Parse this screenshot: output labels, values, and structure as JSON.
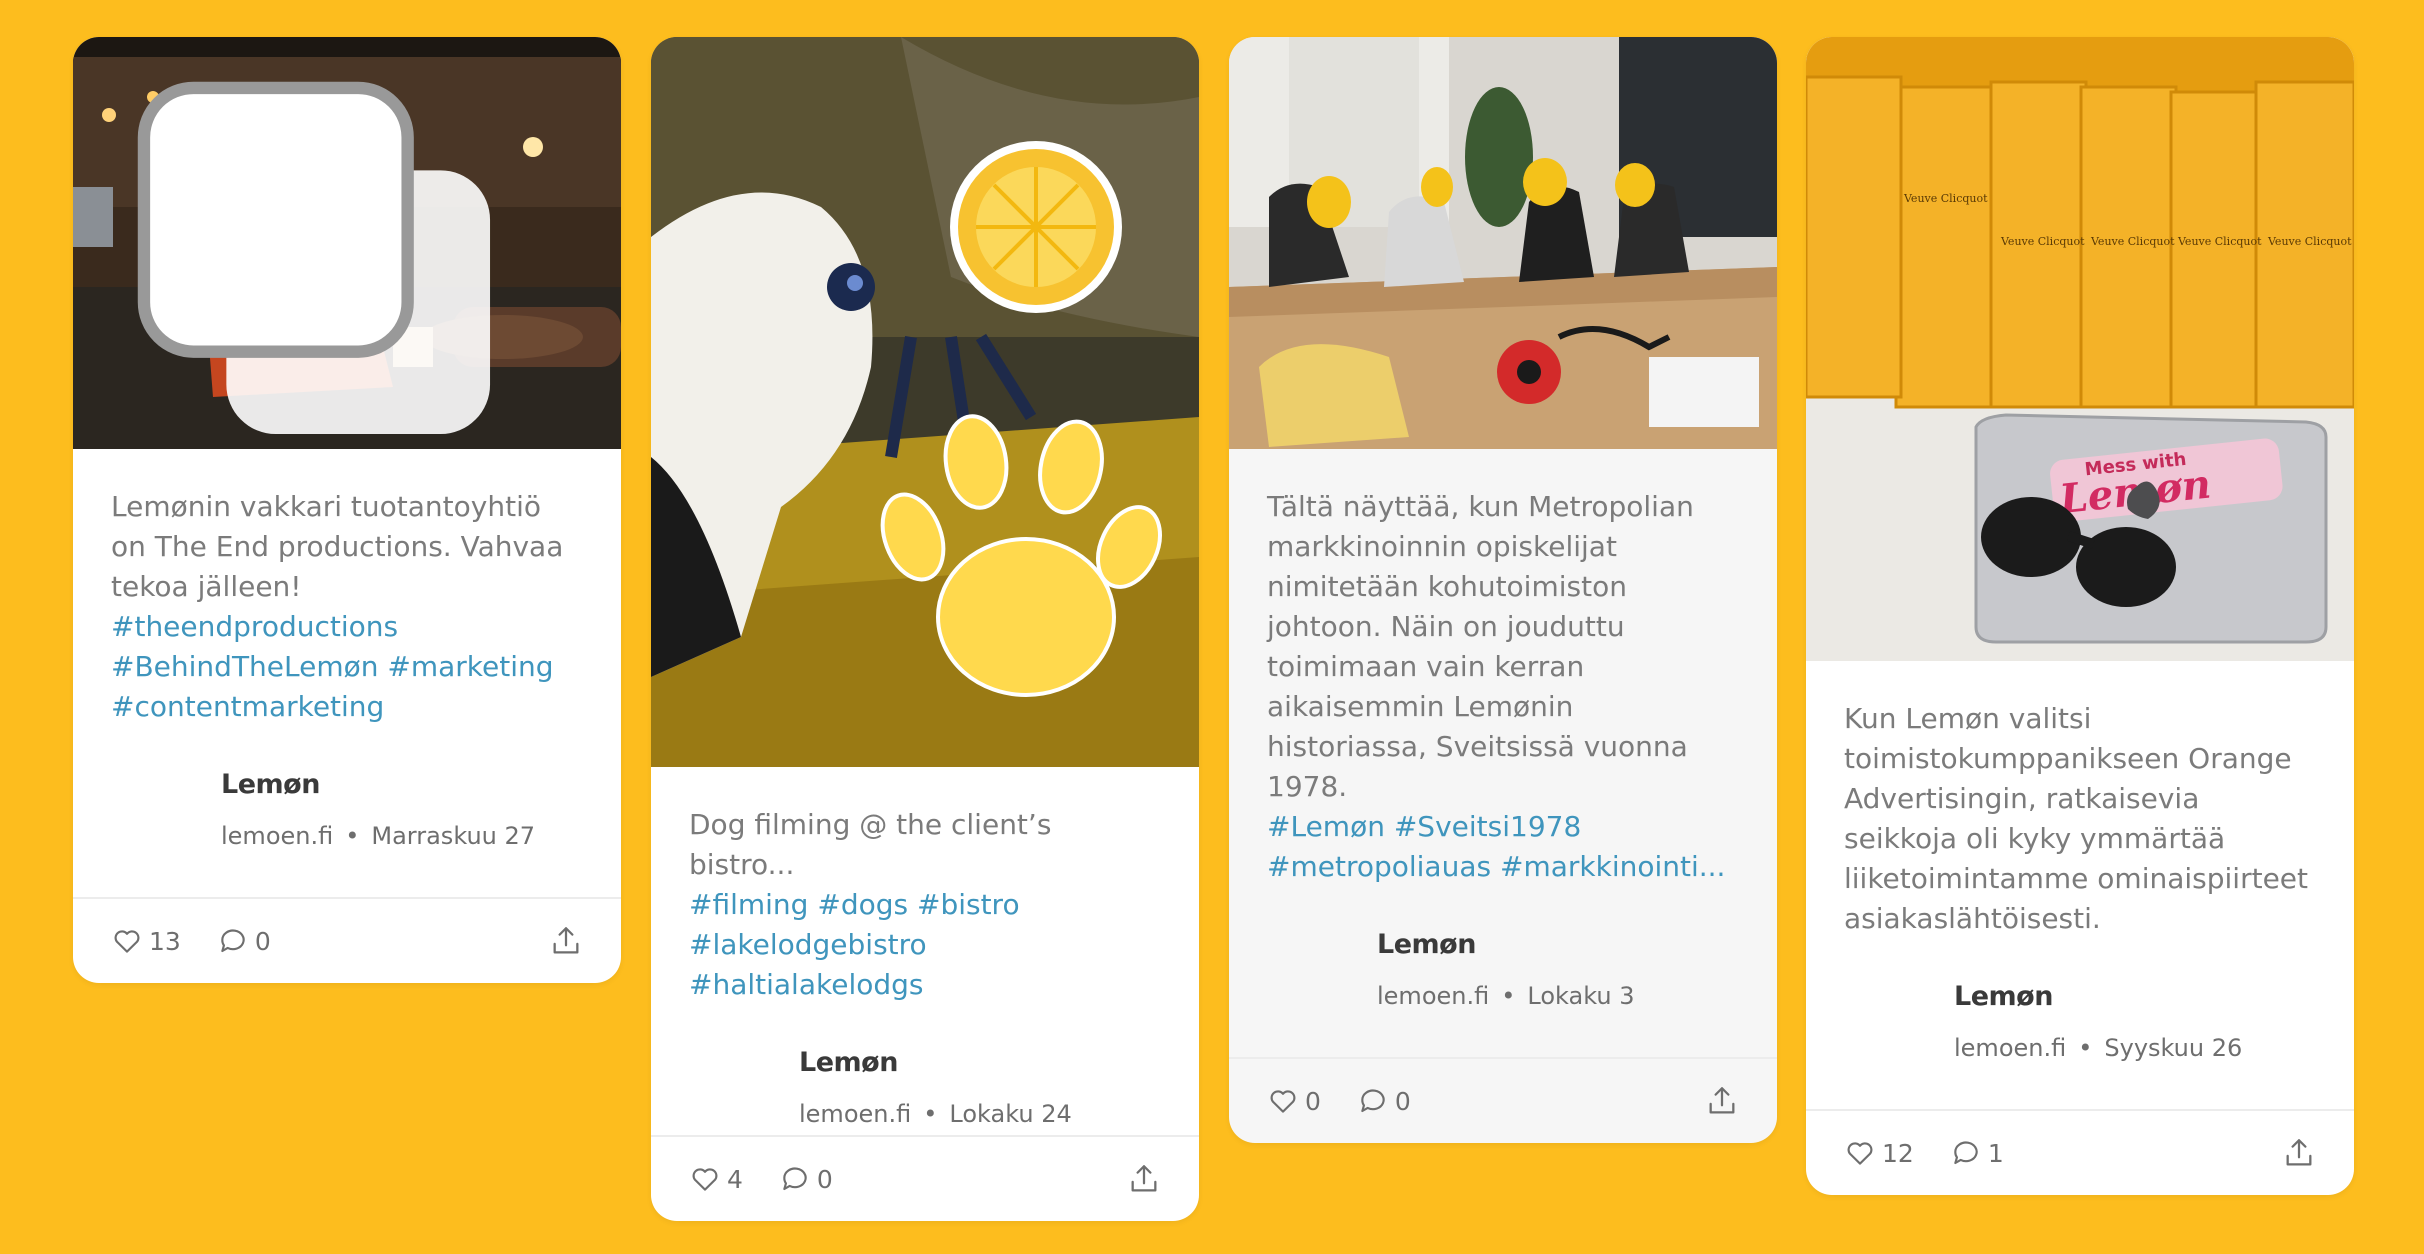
{
  "colors": {
    "background": "#fdbd1e",
    "card": "#ffffff",
    "caption": "#7b7b7b",
    "hashtag": "#3f95bd"
  },
  "posts": [
    {
      "image_desc": "man-in-restaurant-holding-lemon",
      "caption": "Lemønin vakkari tuotantoyhtiö on The End productions. Vahvaa tekoa jälleen!",
      "hashtags": [
        "#theendproductions",
        "#BehindTheLemøn #marketing",
        "#contentmarketing"
      ],
      "author": "Lemøn",
      "site": "lemoen.fi",
      "date": "Marraskuu 27",
      "likes": "13",
      "comments": "0"
    },
    {
      "image_desc": "dog-with-paw-sticker",
      "caption": "Dog filming @ the client’s bistro...",
      "hashtags": [
        "#filming #dogs #bistro",
        "#lakelodgebistro",
        "#haltialakelodgs"
      ],
      "author": "Lemøn",
      "site": "lemoen.fi",
      "date": "Lokaku 24",
      "likes": "4",
      "comments": "0"
    },
    {
      "image_desc": "students-holding-lemons",
      "caption": "Tältä näyttää, kun Metropolian markkinoinnin opiskelijat nimitetään kohutoimiston johtoon. Näin on jouduttu toimimaan vain kerran aikaisemmin Lemønin historiassa, Sveitsissä vuonna 1978.",
      "hashtags": [
        "#Lemøn #Sveitsi1978",
        "#metropoliauas #markkinointi..."
      ],
      "author": "Lemøn",
      "site": "lemoen.fi",
      "date": "Lokaku 3",
      "likes": "0",
      "comments": "0"
    },
    {
      "image_desc": "champagne-boxes-and-laptop",
      "caption": "Kun Lemøn valitsi toimistokumppanikseen Orange Advertisingin, ratkaisevia seikkoja oli kyky ymmärtää liiketoimintamme ominaispiirteet asiakaslähtöisesti.",
      "hashtags": [],
      "author": "Lemøn",
      "site": "lemoen.fi",
      "date": "Syyskuu 26",
      "likes": "12",
      "comments": "1",
      "image_text": {
        "sticker_small": "Mess with",
        "sticker_big": "Lemøn",
        "box_brand": "Veuve Clicquot"
      }
    }
  ]
}
